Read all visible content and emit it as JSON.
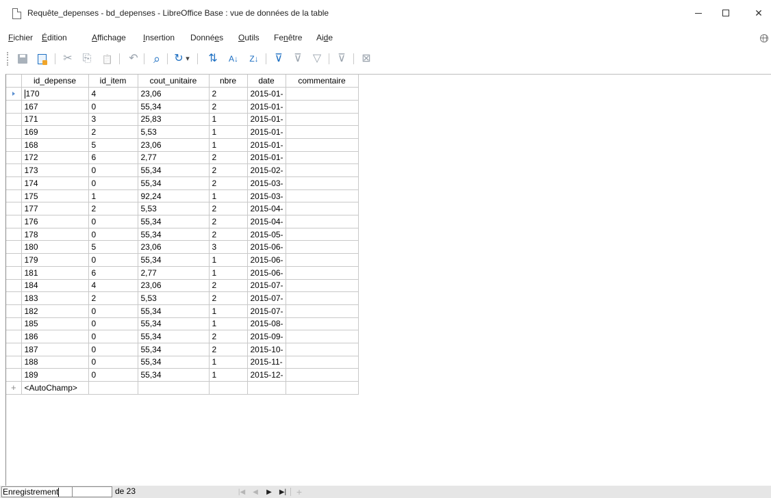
{
  "window": {
    "title": "Requête_depenses - bd_depenses - LibreOffice Base : vue de données de la table",
    "minimize_icon": "minimize-icon",
    "maximize_icon": "maximize-icon",
    "close_glyph": "✕"
  },
  "menu": [
    {
      "label": "Fichier",
      "accel_before": "",
      "accel": "F",
      "rest": "ichier"
    },
    {
      "label": "Édition",
      "accel_before": "",
      "accel": "É",
      "rest": "dition"
    },
    {
      "label": "Affichage",
      "accel_before": "",
      "accel": "A",
      "rest": "ffichage"
    },
    {
      "label": "Insertion",
      "accel_before": "",
      "accel": "I",
      "rest": "nsertion"
    },
    {
      "label": "Données",
      "accel_before": "Donné",
      "accel": "e",
      "rest": "s"
    },
    {
      "label": "Outils",
      "accel_before": "",
      "accel": "O",
      "rest": "utils"
    },
    {
      "label": "Fenêtre",
      "accel_before": "Fe",
      "accel": "n",
      "rest": "être"
    },
    {
      "label": "Aide",
      "accel_before": "Ai",
      "accel": "d",
      "rest": "e"
    }
  ],
  "toolbar": {
    "icons": [
      "save-icon",
      "edit-data-icon",
      "cut-icon",
      "copy-icon",
      "paste-icon",
      "undo-icon",
      "find-icon",
      "refresh-icon",
      "refresh-dropdown-icon",
      "sort-icon",
      "sort-ascending-icon",
      "sort-descending-icon",
      "autofilter-icon",
      "standard-filter-icon",
      "apply-filter-icon",
      "reset-filter-icon",
      "delete-record-icon"
    ],
    "glyphs": {
      "cut": "✂",
      "copy": "⎘",
      "paste": "📋",
      "undo": "↶",
      "find": "⌕",
      "refresh": "↻",
      "dropdown": "▾",
      "sort": "⇅",
      "sort_asc": "A↓",
      "sort_desc": "Z↓",
      "autofilter": "⊽",
      "std_filter": "⊽",
      "apply_filter": "▽",
      "reset_filter": "⊽",
      "delete_record": "⊠"
    }
  },
  "grid": {
    "columns": [
      "id_depense",
      "id_item",
      "cout_unitaire",
      "nbre",
      "date",
      "commentaire"
    ],
    "rows": [
      [
        "170",
        "4",
        "23,06",
        "2",
        "2015-01-",
        ""
      ],
      [
        "167",
        "0",
        "55,34",
        "2",
        "2015-01-",
        ""
      ],
      [
        "171",
        "3",
        "25,83",
        "1",
        "2015-01-",
        ""
      ],
      [
        "169",
        "2",
        "5,53",
        "1",
        "2015-01-",
        ""
      ],
      [
        "168",
        "5",
        "23,06",
        "1",
        "2015-01-",
        ""
      ],
      [
        "172",
        "6",
        "2,77",
        "2",
        "2015-01-",
        ""
      ],
      [
        "173",
        "0",
        "55,34",
        "2",
        "2015-02-",
        ""
      ],
      [
        "174",
        "0",
        "55,34",
        "2",
        "2015-03-",
        ""
      ],
      [
        "175",
        "1",
        "92,24",
        "1",
        "2015-03-",
        ""
      ],
      [
        "177",
        "2",
        "5,53",
        "2",
        "2015-04-",
        ""
      ],
      [
        "176",
        "0",
        "55,34",
        "2",
        "2015-04-",
        ""
      ],
      [
        "178",
        "0",
        "55,34",
        "2",
        "2015-05-",
        ""
      ],
      [
        "180",
        "5",
        "23,06",
        "3",
        "2015-06-",
        ""
      ],
      [
        "179",
        "0",
        "55,34",
        "1",
        "2015-06-",
        ""
      ],
      [
        "181",
        "6",
        "2,77",
        "1",
        "2015-06-",
        ""
      ],
      [
        "184",
        "4",
        "23,06",
        "2",
        "2015-07-",
        ""
      ],
      [
        "183",
        "2",
        "5,53",
        "2",
        "2015-07-",
        ""
      ],
      [
        "182",
        "0",
        "55,34",
        "1",
        "2015-07-",
        ""
      ],
      [
        "185",
        "0",
        "55,34",
        "1",
        "2015-08-",
        ""
      ],
      [
        "186",
        "0",
        "55,34",
        "2",
        "2015-09-",
        ""
      ],
      [
        "187",
        "0",
        "55,34",
        "2",
        "2015-10-",
        ""
      ],
      [
        "188",
        "0",
        "55,34",
        "1",
        "2015-11-",
        ""
      ],
      [
        "189",
        "0",
        "55,34",
        "1",
        "2015-12-",
        ""
      ]
    ],
    "new_row_placeholder": "<AutoChamp>",
    "current_row_marker": "current-row-indicator",
    "new_row_marker_glyph": "+"
  },
  "navigation": {
    "record_label": "Enregistrement",
    "record_value": "",
    "count_text": "de 23",
    "buttons": [
      "first-record-icon",
      "previous-record-icon",
      "next-record-icon",
      "last-record-icon",
      "new-record-icon"
    ],
    "glyphs": {
      "first": "|◀",
      "prev": "◀",
      "next": "▶",
      "last": "▶|",
      "new": "+"
    }
  }
}
